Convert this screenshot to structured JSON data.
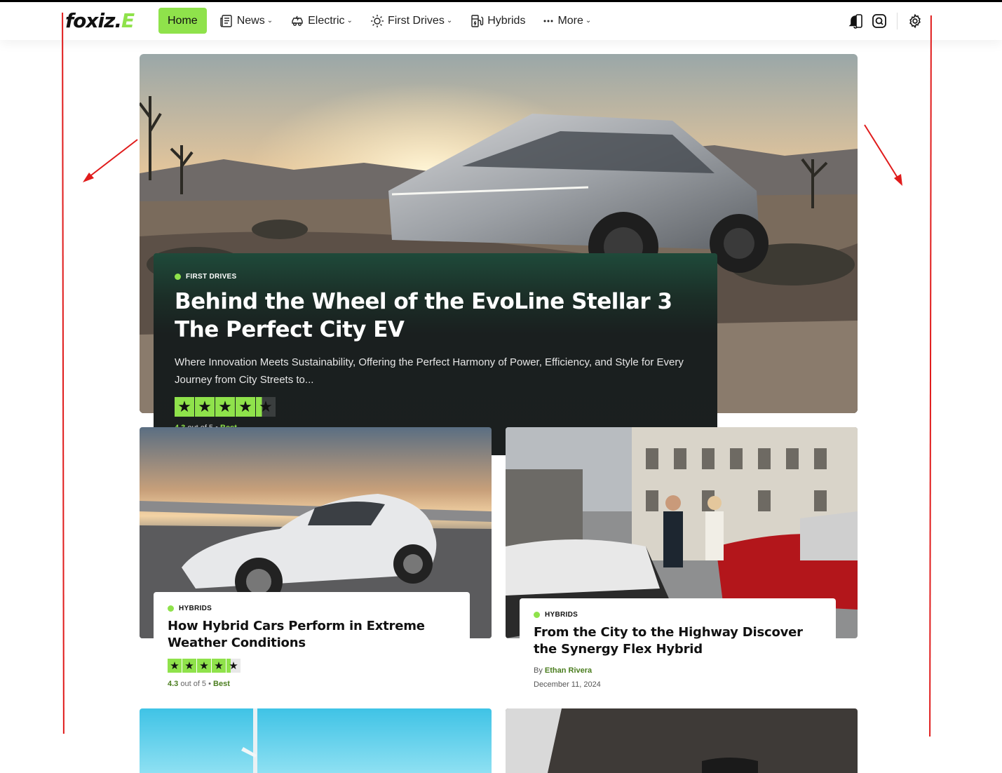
{
  "brand": {
    "logo_text": "foxiz.",
    "logo_mark": "E",
    "accent": "#8fe24b"
  },
  "nav": {
    "items": [
      {
        "label": "Home",
        "icon": "",
        "dropdown": false
      },
      {
        "label": "News",
        "icon": "news-icon",
        "dropdown": true
      },
      {
        "label": "Electric",
        "icon": "electric-car-icon",
        "dropdown": true
      },
      {
        "label": "First Drives",
        "icon": "sun-icon",
        "dropdown": true
      },
      {
        "label": "Hybrids",
        "icon": "fuel-pump-icon",
        "dropdown": false
      },
      {
        "label": "More",
        "icon": "ellipsis-icon",
        "dropdown": true
      }
    ]
  },
  "header_tools": [
    "notification-bell-icon",
    "search-icon",
    "settings-gear-icon"
  ],
  "hero": {
    "category": "FIRST DRIVES",
    "title": "Behind the Wheel of the EvoLine Stellar 3 The Perfect City EV",
    "excerpt": "Where Innovation Meets Sustainability, Offering the Perfect Harmony of Power, Efficiency, and Style for Every Journey from City Streets to...",
    "rating": {
      "score": "4.3",
      "out_of": "out of 5",
      "label": "Best",
      "value": 4.3
    }
  },
  "cards": [
    {
      "category": "HYBRIDS",
      "title": "How Hybrid Cars Perform in Extreme Weather Conditions",
      "rating": {
        "score": "4.3",
        "out_of": "out of 5",
        "label": "Best",
        "value": 4.3
      }
    },
    {
      "category": "HYBRIDS",
      "title": "From the City to the Highway Discover the Synergy Flex Hybrid",
      "by": "By",
      "author": "Ethan Rivera",
      "date": "December 11, 2024"
    }
  ]
}
